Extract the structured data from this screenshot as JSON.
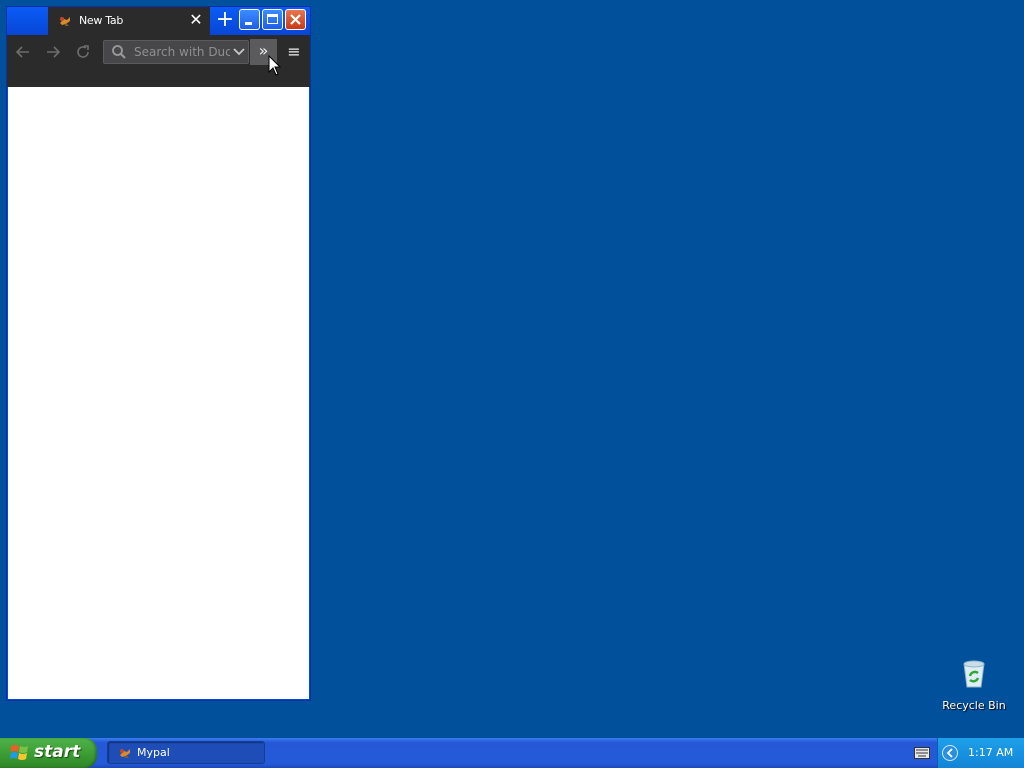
{
  "browser": {
    "tab_title": "New Tab",
    "search_placeholder": "Search with DuckDuckGo",
    "overflow_glyph": "»",
    "menu_glyph": "≡"
  },
  "desktop": {
    "recycle_bin_label": "Recycle Bin"
  },
  "taskbar": {
    "start_label": "start",
    "task_app_label": "Mypal",
    "clock": "1:17 AM"
  },
  "colors": {
    "desktop": "#00509c",
    "toolbar": "#2b2b2b",
    "title_blue": "#0a5cf5",
    "taskbar": "#245ad9",
    "start_green": "#3a9a32",
    "tray": "#1384d6"
  }
}
